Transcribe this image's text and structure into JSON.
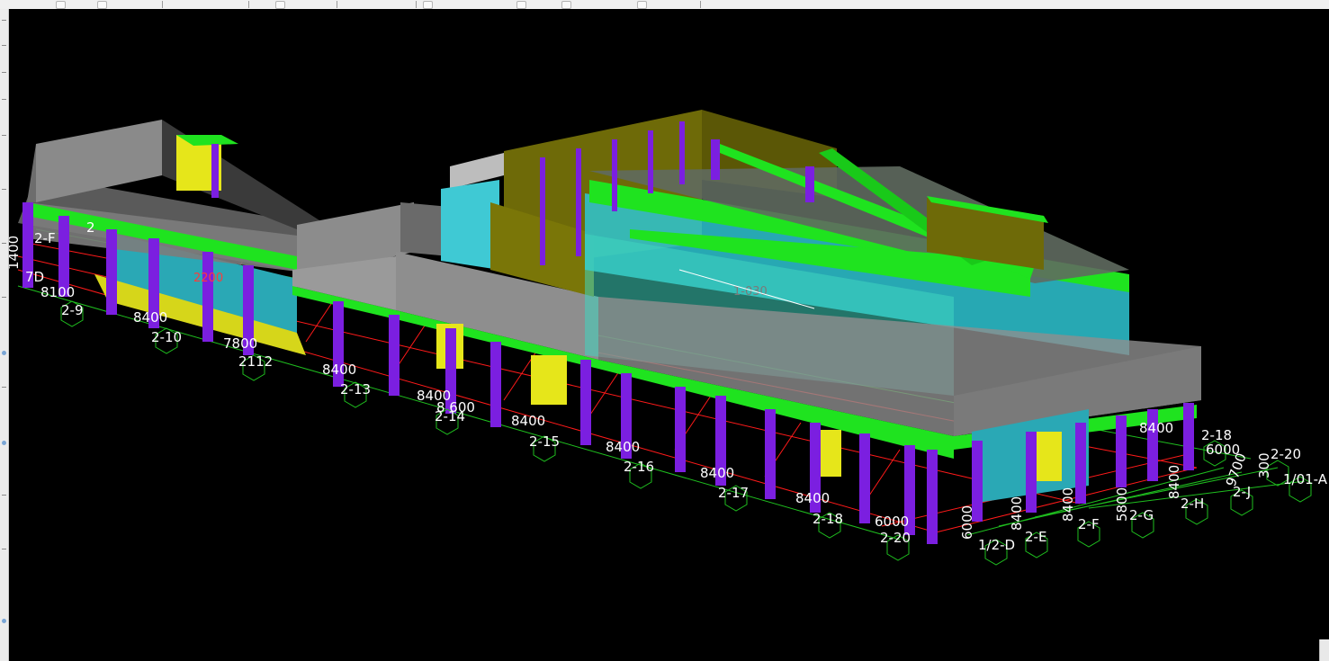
{
  "viewport": {
    "background": "#000000",
    "colors": {
      "column": "#7b1fe0",
      "beam": "#1fe31f",
      "wall_gray": "#8c8c8c",
      "glass": "#3ccfd6",
      "yellow": "#e6e61a",
      "olive": "#6e6a08",
      "grid_red": "#ff1a1a",
      "grid_green": "#1fbf1f"
    },
    "grid_labels": [
      "2-F",
      "2",
      "1400",
      "7D",
      "8100",
      "2-9",
      "8400",
      "2-10",
      "7800",
      "2112",
      "8400",
      "2-13",
      "8400",
      "8 600",
      "2-14",
      "8400",
      "2-15",
      "8400",
      "2-16",
      "8400",
      "2-17",
      "8400",
      "2-18",
      "6000",
      "2-20",
      "6000",
      "1/2-D",
      "2-E",
      "8400",
      "2-F",
      "8400",
      "2-G",
      "5800",
      "2-H",
      "8400",
      "2-J",
      "9700",
      "1/01-A",
      "300",
      "2-20",
      "6000",
      "2-18",
      "8400"
    ],
    "dimension_labels": [
      "2200",
      "1-030"
    ]
  }
}
